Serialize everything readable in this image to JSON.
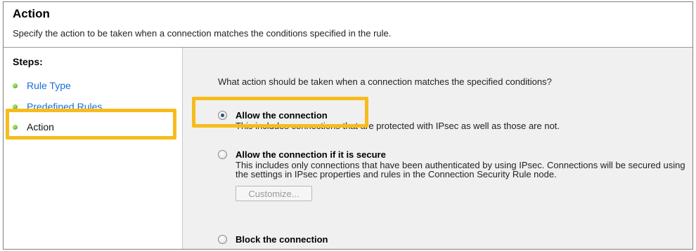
{
  "header": {
    "title": "Action",
    "description": "Specify the action to be taken when a connection matches the conditions specified in the rule."
  },
  "sidebar": {
    "steps_label": "Steps:",
    "steps": [
      {
        "label": "Rule Type",
        "state": "link"
      },
      {
        "label": "Predefined Rules",
        "state": "link"
      },
      {
        "label": "Action",
        "state": "current"
      }
    ]
  },
  "main": {
    "question": "What action should be taken when a connection matches the specified conditions?",
    "options": [
      {
        "title": "Allow the connection",
        "selected": true,
        "description": "This includes connections that are protected with IPsec as well as those are not."
      },
      {
        "title": "Allow the connection if it is secure",
        "selected": false,
        "description": "This includes only connections that have been authenticated by using IPsec. Connections will be secured using the settings in IPsec properties and rules in the Connection Security Rule node.",
        "button_label": "Customize..."
      },
      {
        "title": "Block the connection",
        "selected": false
      }
    ]
  },
  "colors": {
    "highlight": "#f7bc1c",
    "link": "#1a6fd6",
    "content_background": "#f0f0f0"
  }
}
